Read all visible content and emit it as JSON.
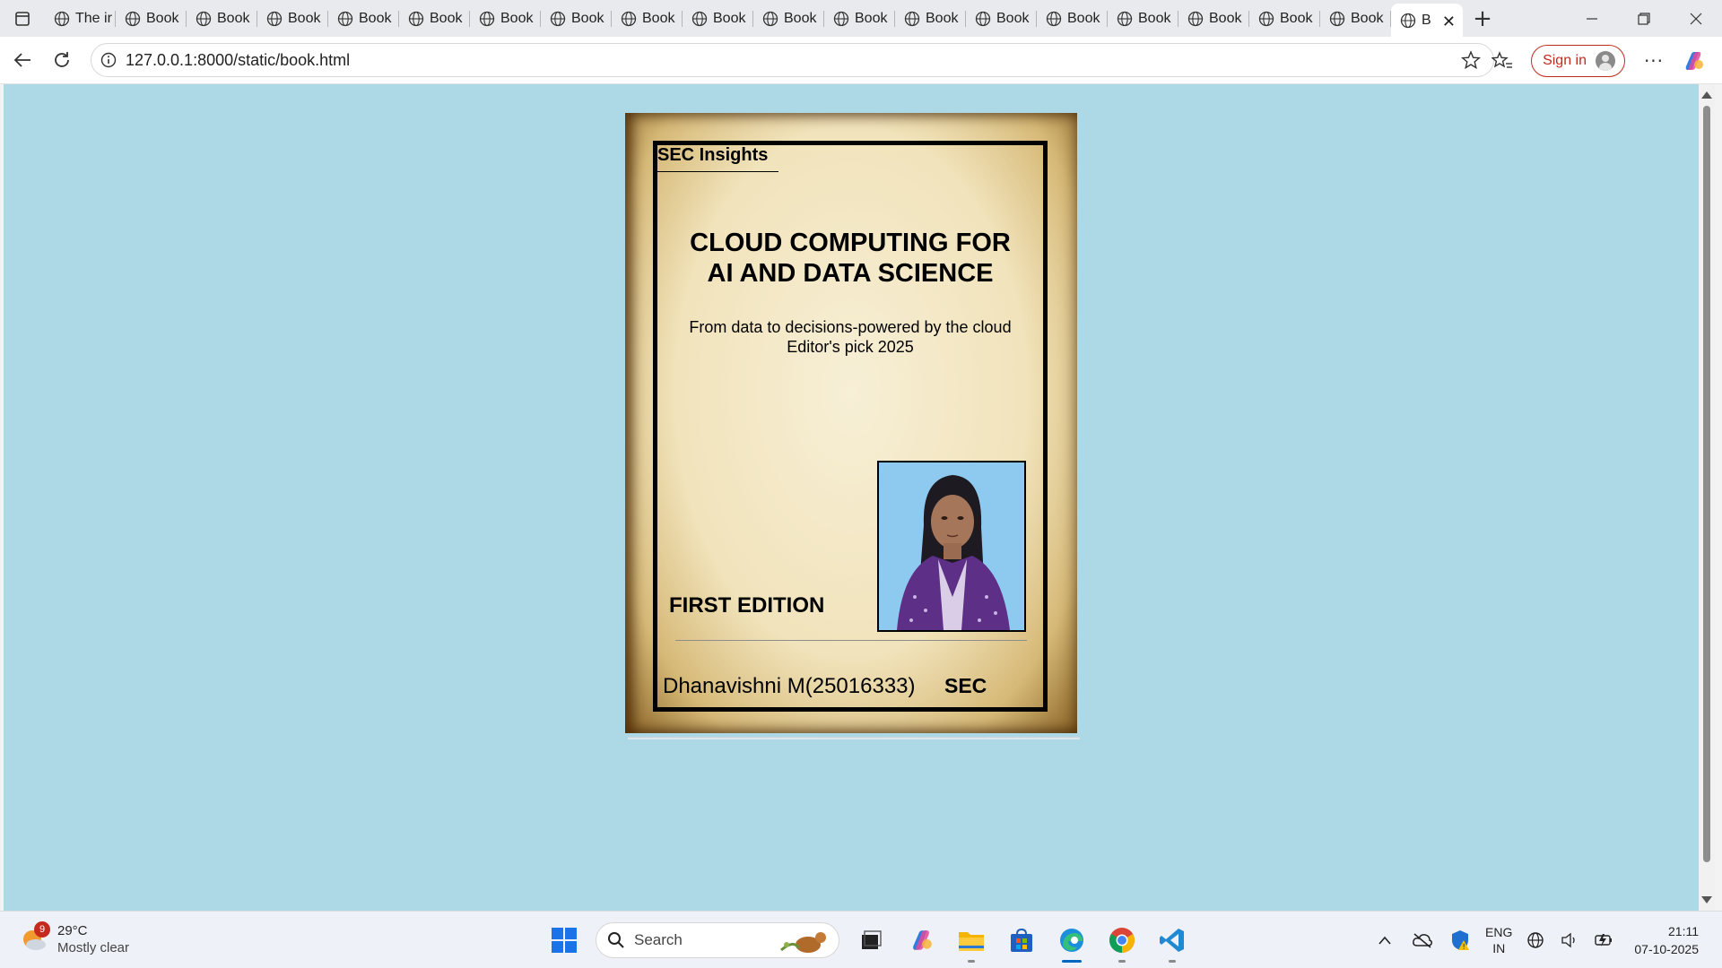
{
  "browser": {
    "tabs": [
      {
        "label": "The ir"
      },
      {
        "label": "Book"
      },
      {
        "label": "Book"
      },
      {
        "label": "Book"
      },
      {
        "label": "Book"
      },
      {
        "label": "Book"
      },
      {
        "label": "Book"
      },
      {
        "label": "Book"
      },
      {
        "label": "Book"
      },
      {
        "label": "Book"
      },
      {
        "label": "Book"
      },
      {
        "label": "Book"
      },
      {
        "label": "Book"
      },
      {
        "label": "Book"
      },
      {
        "label": "Book"
      },
      {
        "label": "Book"
      },
      {
        "label": "Book"
      },
      {
        "label": "Book"
      },
      {
        "label": "Book"
      },
      {
        "label": "B"
      }
    ],
    "url": "127.0.0.1:8000/static/book.html",
    "sign_in_label": "Sign in"
  },
  "book": {
    "publisher": "SEC Insights",
    "title_line1": "CLOUD COMPUTING FOR",
    "title_line2": "AI AND DATA SCIENCE",
    "tagline_line1": "From data to decisions-powered by the cloud",
    "tagline_line2": "Editor's pick 2025",
    "edition": "FIRST EDITION",
    "author": "Dhanavishni M(25016333)",
    "organization": "SEC"
  },
  "taskbar": {
    "weather_badge": "9",
    "temperature": "29°C",
    "condition": "Mostly clear",
    "search_placeholder": "Search",
    "language_line1": "ENG",
    "language_line2": "IN",
    "time": "21:11",
    "date": "07-10-2025"
  },
  "colors": {
    "page_background": "#add8e6",
    "sign_in_accent": "#c42b1c"
  }
}
